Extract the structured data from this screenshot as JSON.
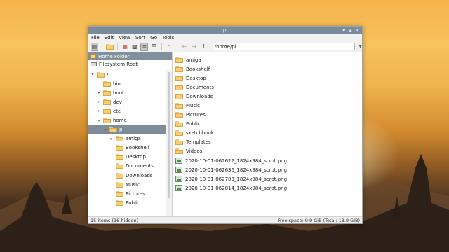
{
  "window": {
    "title": "pi"
  },
  "window_buttons": {
    "minimize": "▾",
    "maximize": "▴",
    "close": "✕"
  },
  "menu": [
    "File",
    "Edit",
    "View",
    "Sort",
    "Go",
    "Tools"
  ],
  "toolbar": {
    "path": "/home/pi",
    "icons": [
      "side-pane-icon",
      "new-folder-icon",
      "cut-icon",
      "icon-view-icon",
      "thumbnail-view-icon",
      "compact-view-icon",
      "list-view-icon",
      "home-icon",
      "back-icon",
      "forward-icon",
      "up-icon"
    ]
  },
  "sidebar": {
    "header": "Home Folder",
    "root": "Filesystem Root",
    "tree": [
      {
        "label": "/",
        "level": 0,
        "arrow": "▾"
      },
      {
        "label": "bin",
        "level": 1,
        "arrow": ""
      },
      {
        "label": "boot",
        "level": 1,
        "arrow": "▸"
      },
      {
        "label": "dev",
        "level": 1,
        "arrow": "▸"
      },
      {
        "label": "etc",
        "level": 1,
        "arrow": "▸"
      },
      {
        "label": "home",
        "level": 1,
        "arrow": "▾"
      },
      {
        "label": "pi",
        "level": 2,
        "arrow": "▾",
        "selected": true
      },
      {
        "label": "amiga",
        "level": 3,
        "arrow": "▸"
      },
      {
        "label": "Bookshelf",
        "level": 3,
        "arrow": ""
      },
      {
        "label": "Desktop",
        "level": 3,
        "arrow": ""
      },
      {
        "label": "Documents",
        "level": 3,
        "arrow": ""
      },
      {
        "label": "Downloads",
        "level": 3,
        "arrow": ""
      },
      {
        "label": "Music",
        "level": 3,
        "arrow": ""
      },
      {
        "label": "Pictures",
        "level": 3,
        "arrow": ""
      },
      {
        "label": "Public",
        "level": 3,
        "arrow": ""
      }
    ]
  },
  "files": [
    {
      "name": "amiga",
      "type": "folder"
    },
    {
      "name": "Bookshelf",
      "type": "folder"
    },
    {
      "name": "Desktop",
      "type": "folder"
    },
    {
      "name": "Documents",
      "type": "folder"
    },
    {
      "name": "Downloads",
      "type": "folder"
    },
    {
      "name": "Music",
      "type": "folder"
    },
    {
      "name": "Pictures",
      "type": "folder"
    },
    {
      "name": "Public",
      "type": "folder"
    },
    {
      "name": "sketchbook",
      "type": "folder"
    },
    {
      "name": "Templates",
      "type": "folder"
    },
    {
      "name": "Videos",
      "type": "folder"
    },
    {
      "name": "2020-10-01-062622_1824x984_scrot.png",
      "type": "image"
    },
    {
      "name": "2020-10-01-062636_1824x984_scrot.png",
      "type": "image"
    },
    {
      "name": "2020-10-01-062703_1824x984_scrot.png",
      "type": "image"
    },
    {
      "name": "2020-10-01-062814_1824x984_scrot.png",
      "type": "image"
    }
  ],
  "status": {
    "left": "15 items (16 hidden)",
    "right": "Free space: 9.9 GiB (Total: 13.9 GiB)"
  }
}
